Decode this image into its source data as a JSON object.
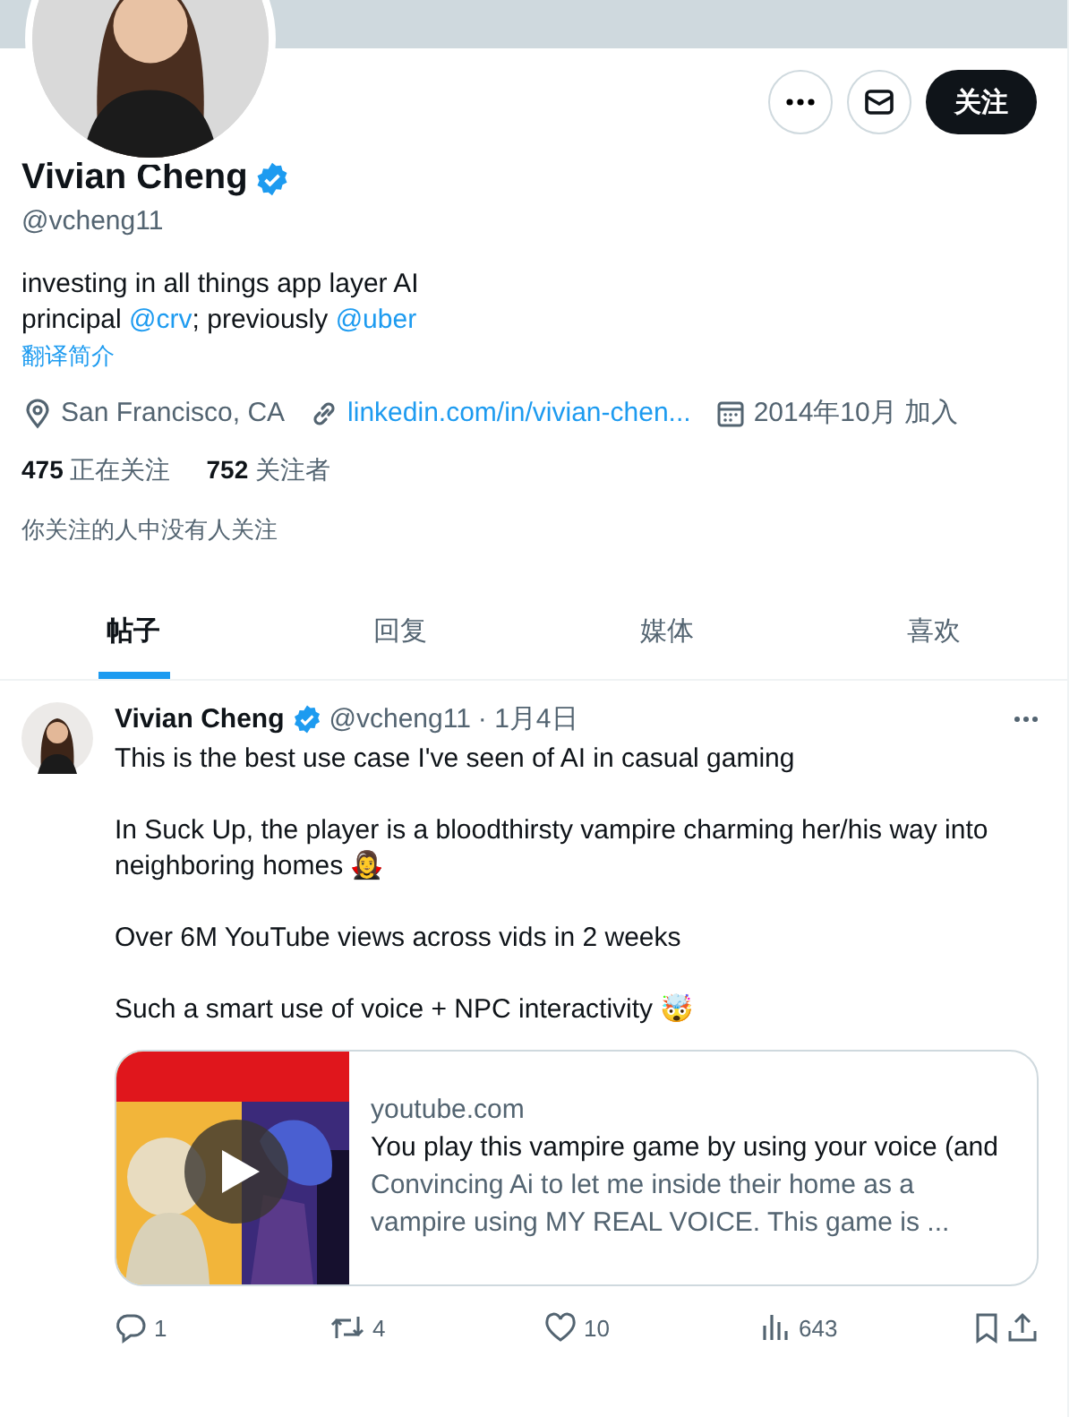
{
  "profile": {
    "name": "Vivian Cheng",
    "verified": true,
    "handle": "@vcheng11",
    "follow_button": "关注",
    "bio": [
      [
        {
          "text": "investing in all things app layer AI"
        }
      ],
      [
        {
          "text": "principal "
        },
        {
          "text": "@crv",
          "link": true
        },
        {
          "text": "; previously "
        },
        {
          "text": "@uber",
          "link": true
        }
      ]
    ],
    "translate": "翻译简介",
    "meta": [
      {
        "kind": "location",
        "text": "San Francisco, CA"
      },
      {
        "kind": "link",
        "text": "linkedin.com/in/vivian-chen..."
      },
      {
        "kind": "joined",
        "text": "2014年10月 加入"
      }
    ],
    "stats": [
      {
        "count": "475",
        "label": "正在关注"
      },
      {
        "count": "752",
        "label": "关注者"
      }
    ],
    "followers_note": "你关注的人中没有人关注"
  },
  "tabs": [
    {
      "label": "帖子",
      "selected": true
    },
    {
      "label": "回复",
      "selected": false
    },
    {
      "label": "媒体",
      "selected": false
    },
    {
      "label": "喜欢",
      "selected": false
    }
  ],
  "post": {
    "name": "Vivian Cheng",
    "verified": true,
    "handle": "@vcheng11",
    "date": "· 1月4日",
    "paragraphs": [
      {
        "text": "This is the best use case I've seen of AI in casual gaming"
      },
      {
        "text": "In Suck Up, the player is a bloodthirsty vampire  charming her/his way into neighboring homes 🧛‍♀️"
      },
      {
        "text": "Over 6M YouTube views across vids in 2 weeks"
      },
      {
        "text": "Such a smart use of voice + NPC interactivity 🤯"
      }
    ],
    "card": {
      "kind": "picture",
      "domain": "youtube.com",
      "title": "You play this vampire game by using your voice (and",
      "description": "Convincing Ai to let me inside their home as a vampire using MY REAL VOICE. This game is ..."
    },
    "actions": [
      {
        "kind": "reply",
        "count": "1"
      },
      {
        "kind": "repost",
        "count": "4"
      },
      {
        "kind": "like",
        "count": "10"
      },
      {
        "kind": "views",
        "count": "643"
      },
      {
        "kind": "bookmark"
      },
      {
        "kind": "share"
      }
    ]
  }
}
